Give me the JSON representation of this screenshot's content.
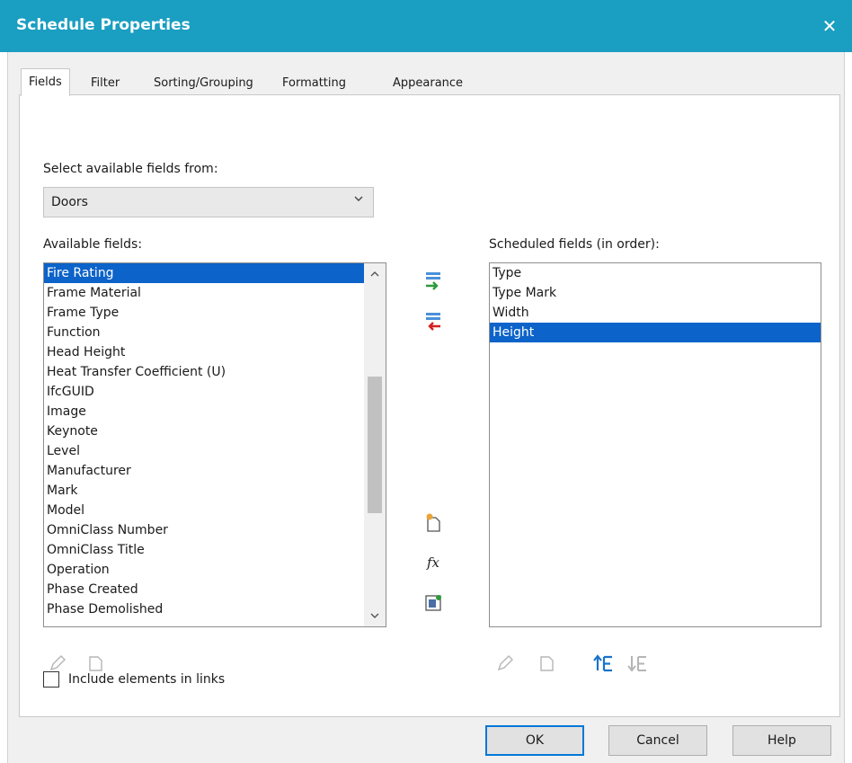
{
  "window": {
    "title": "Schedule Properties",
    "close_glyph": "✕"
  },
  "tabs": [
    {
      "label": "Fields",
      "active": true
    },
    {
      "label": "Filter"
    },
    {
      "label": "Sorting/Grouping"
    },
    {
      "label": "Formatting"
    },
    {
      "label": "Appearance"
    }
  ],
  "fields": {
    "select_from_label": "Select available fields from:",
    "category_value": "Doors",
    "available_label": "Available fields:",
    "available_items": [
      "Fire Rating",
      "Frame Material",
      "Frame Type",
      "Function",
      "Head Height",
      "Heat Transfer Coefficient (U)",
      "IfcGUID",
      "Image",
      "Keynote",
      "Level",
      "Manufacturer",
      "Mark",
      "Model",
      "OmniClass Number",
      "OmniClass Title",
      "Operation",
      "Phase Created",
      "Phase Demolished"
    ],
    "available_selected": "Fire Rating",
    "scheduled_label": "Scheduled fields (in order):",
    "scheduled_items": [
      "Type",
      "Type Mark",
      "Width",
      "Height"
    ],
    "scheduled_selected": "Height",
    "include_links_label": "Include elements in links",
    "include_links_checked": false,
    "formula_glyph": "fx"
  },
  "buttons": {
    "ok": "OK",
    "cancel": "Cancel",
    "help": "Help"
  },
  "icons": {
    "add": "add-parameter-icon",
    "remove": "remove-parameter-icon",
    "new_param": "new-parameter-icon",
    "formula": "calculated-value-icon",
    "combine": "combine-parameters-icon",
    "edit": "edit-parameter-icon",
    "delete": "delete-parameter-icon",
    "move_up": "move-up-icon",
    "move_down": "move-down-icon"
  },
  "colors": {
    "titlebar": "#1a9ec1",
    "selection": "#0c63c9",
    "add_arrow": "#2e9a3a",
    "remove_arrow": "#d42020"
  }
}
